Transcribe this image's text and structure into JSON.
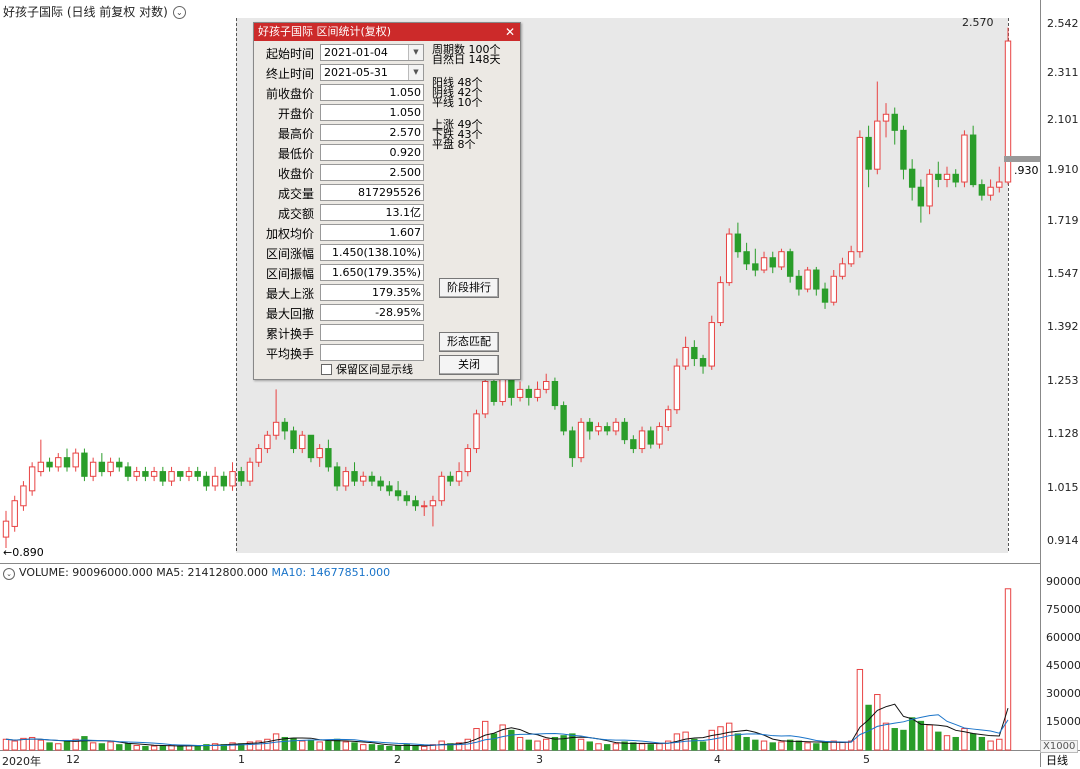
{
  "window": {
    "title": "好孩子国际 (日线 前复权 对数)",
    "period_tab": "日线",
    "colors": {
      "up": "#e84343",
      "down": "#2a9d2a",
      "ma5": "#111111",
      "ma10": "#1a74c9",
      "selection": "#e8e8e8",
      "dialog_title": "#cc2a2a"
    }
  },
  "price_axis": {
    "labels": [
      "2.542",
      "2.311",
      "2.101",
      "1.910",
      "1.719",
      "1.547",
      "1.392",
      "1.253",
      "1.128",
      "1.015",
      "0.914"
    ]
  },
  "price_annotations": {
    "high_label": "2.570",
    "low_label": "0.890",
    "current_label": ".930"
  },
  "volume_legend": {
    "name": "VOLUME: 90096000.000",
    "ma5": "MA5: 21412800.000",
    "ma10": "MA10: 14677851.000"
  },
  "volume_axis": {
    "labels": [
      "90000",
      "75000",
      "60000",
      "45000",
      "30000",
      "15000"
    ],
    "unit": "X1000"
  },
  "date_axis": {
    "labels": [
      "2020年",
      "12",
      "1",
      "2",
      "3",
      "4",
      "5"
    ]
  },
  "dialog": {
    "title": "好孩子国际 区间统计(复权)",
    "fields": [
      {
        "label": "起始时间",
        "value": "2021-01-04",
        "type": "date"
      },
      {
        "label": "终止时间",
        "value": "2021-05-31",
        "type": "date"
      },
      {
        "label": "前收盘价",
        "value": "1.050"
      },
      {
        "label": "开盘价",
        "value": "1.050"
      },
      {
        "label": "最高价",
        "value": "2.570"
      },
      {
        "label": "最低价",
        "value": "0.920"
      },
      {
        "label": "收盘价",
        "value": "2.500"
      },
      {
        "label": "成交量",
        "value": "817295526"
      },
      {
        "label": "成交额",
        "value": "13.1亿"
      },
      {
        "label": "加权均价",
        "value": "1.607"
      },
      {
        "label": "区间涨幅",
        "value": "1.450(138.10%)"
      },
      {
        "label": "区间振幅",
        "value": "1.650(179.35%)"
      },
      {
        "label": "最大上涨",
        "value": "179.35%"
      },
      {
        "label": "最大回撤",
        "value": "-28.95%"
      },
      {
        "label": "累计换手",
        "value": ""
      },
      {
        "label": "平均换手",
        "value": ""
      }
    ],
    "stats": [
      "周期数 100个",
      "自然日 148天",
      "阳线 48个",
      "阴线 42个",
      "平线 10个",
      "上涨 49个",
      "下跌 43个",
      "平盘 8个"
    ],
    "buttons": {
      "rank": "阶段排行",
      "pattern": "形态匹配",
      "close": "关闭"
    },
    "keep_checkbox_label": "保留区间显示线"
  },
  "chart_data": {
    "type": "candlestick",
    "title": "好孩子国际 (日线 前复权 对数)",
    "y_scale": "log",
    "y_range": [
      0.88,
      2.6
    ],
    "volume_range": [
      0,
      95000
    ],
    "volume_unit": "X1000",
    "selected_range": [
      "2021-01-04",
      "2021-05-31"
    ],
    "candles": [
      [
        0.9,
        0.93,
        0.88,
        0.95,
        6000
      ],
      [
        0.92,
        0.97,
        0.91,
        0.98,
        5000
      ],
      [
        0.96,
        1.0,
        0.95,
        1.01,
        6500
      ],
      [
        0.99,
        1.04,
        0.98,
        1.05,
        7000
      ],
      [
        1.03,
        1.05,
        1.02,
        1.1,
        5500
      ],
      [
        1.05,
        1.04,
        1.03,
        1.06,
        4000
      ],
      [
        1.04,
        1.06,
        1.03,
        1.07,
        3500
      ],
      [
        1.06,
        1.04,
        1.03,
        1.08,
        5000
      ],
      [
        1.04,
        1.07,
        1.03,
        1.08,
        6000
      ],
      [
        1.07,
        1.02,
        1.01,
        1.08,
        7500
      ],
      [
        1.02,
        1.05,
        1.01,
        1.06,
        4000
      ],
      [
        1.05,
        1.03,
        1.02,
        1.07,
        3500
      ],
      [
        1.03,
        1.05,
        1.02,
        1.06,
        4500
      ],
      [
        1.05,
        1.04,
        1.03,
        1.06,
        3000
      ],
      [
        1.04,
        1.02,
        1.01,
        1.05,
        3500
      ],
      [
        1.02,
        1.03,
        1.01,
        1.04,
        2500
      ],
      [
        1.03,
        1.02,
        1.01,
        1.04,
        2000
      ],
      [
        1.02,
        1.03,
        1.01,
        1.04,
        2200
      ],
      [
        1.03,
        1.01,
        1.0,
        1.04,
        2400
      ],
      [
        1.01,
        1.03,
        1.0,
        1.04,
        2600
      ],
      [
        1.03,
        1.02,
        1.01,
        1.03,
        2000
      ],
      [
        1.02,
        1.03,
        1.01,
        1.04,
        2300
      ],
      [
        1.03,
        1.02,
        1.01,
        1.04,
        2500
      ],
      [
        1.02,
        1.0,
        0.99,
        1.03,
        3000
      ],
      [
        1.0,
        1.02,
        0.99,
        1.04,
        3500
      ],
      [
        1.02,
        1.0,
        0.99,
        1.03,
        3000
      ],
      [
        1.0,
        1.03,
        0.99,
        1.05,
        4000
      ],
      [
        1.03,
        1.01,
        1.0,
        1.04,
        3500
      ],
      [
        1.01,
        1.05,
        1.0,
        1.06,
        4500
      ],
      [
        1.05,
        1.08,
        1.04,
        1.09,
        5000
      ],
      [
        1.08,
        1.11,
        1.07,
        1.12,
        6000
      ],
      [
        1.11,
        1.14,
        1.1,
        1.22,
        9000
      ],
      [
        1.14,
        1.12,
        1.1,
        1.15,
        7000
      ],
      [
        1.12,
        1.08,
        1.07,
        1.13,
        6500
      ],
      [
        1.08,
        1.11,
        1.07,
        1.12,
        5000
      ],
      [
        1.11,
        1.06,
        1.05,
        1.11,
        5500
      ],
      [
        1.06,
        1.08,
        1.04,
        1.09,
        4500
      ],
      [
        1.08,
        1.04,
        1.03,
        1.1,
        5000
      ],
      [
        1.04,
        1.0,
        0.99,
        1.05,
        6000
      ],
      [
        1.0,
        1.03,
        0.99,
        1.04,
        4500
      ],
      [
        1.03,
        1.01,
        1.0,
        1.05,
        4000
      ],
      [
        1.01,
        1.02,
        1.0,
        1.03,
        3000
      ],
      [
        1.02,
        1.01,
        1.0,
        1.03,
        3000
      ],
      [
        1.01,
        1.0,
        0.99,
        1.02,
        2500
      ],
      [
        1.0,
        0.99,
        0.98,
        1.01,
        2000
      ],
      [
        0.99,
        0.98,
        0.97,
        1.01,
        2500
      ],
      [
        0.98,
        0.97,
        0.96,
        0.99,
        3000
      ],
      [
        0.97,
        0.96,
        0.95,
        0.98,
        2500
      ],
      [
        0.96,
        0.96,
        0.94,
        0.97,
        2000
      ],
      [
        0.96,
        0.97,
        0.92,
        0.98,
        3000
      ],
      [
        0.97,
        1.02,
        0.96,
        1.03,
        5000
      ],
      [
        1.02,
        1.01,
        1.0,
        1.03,
        3500
      ],
      [
        1.01,
        1.03,
        1.0,
        1.05,
        4000
      ],
      [
        1.03,
        1.08,
        1.02,
        1.09,
        6000
      ],
      [
        1.08,
        1.16,
        1.07,
        1.17,
        12000
      ],
      [
        1.16,
        1.24,
        1.15,
        1.26,
        16000
      ],
      [
        1.24,
        1.19,
        1.18,
        1.25,
        9000
      ],
      [
        1.19,
        1.27,
        1.18,
        1.28,
        14000
      ],
      [
        1.27,
        1.2,
        1.18,
        1.28,
        11000
      ],
      [
        1.2,
        1.22,
        1.19,
        1.24,
        7000
      ],
      [
        1.22,
        1.2,
        1.18,
        1.23,
        5500
      ],
      [
        1.2,
        1.22,
        1.19,
        1.24,
        5000
      ],
      [
        1.22,
        1.24,
        1.21,
        1.26,
        6000
      ],
      [
        1.24,
        1.18,
        1.17,
        1.25,
        7000
      ],
      [
        1.18,
        1.12,
        1.11,
        1.19,
        8000
      ],
      [
        1.12,
        1.06,
        1.04,
        1.13,
        9000
      ],
      [
        1.06,
        1.14,
        1.05,
        1.15,
        6000
      ],
      [
        1.14,
        1.12,
        1.1,
        1.15,
        4500
      ],
      [
        1.12,
        1.13,
        1.11,
        1.14,
        3500
      ],
      [
        1.13,
        1.12,
        1.11,
        1.14,
        3000
      ],
      [
        1.12,
        1.14,
        1.11,
        1.15,
        3500
      ],
      [
        1.14,
        1.1,
        1.09,
        1.15,
        4500
      ],
      [
        1.1,
        1.08,
        1.07,
        1.11,
        4000
      ],
      [
        1.08,
        1.12,
        1.07,
        1.13,
        3500
      ],
      [
        1.12,
        1.09,
        1.08,
        1.13,
        3000
      ],
      [
        1.09,
        1.13,
        1.08,
        1.14,
        3500
      ],
      [
        1.13,
        1.17,
        1.12,
        1.18,
        5000
      ],
      [
        1.17,
        1.28,
        1.16,
        1.3,
        9000
      ],
      [
        1.28,
        1.33,
        1.27,
        1.36,
        10000
      ],
      [
        1.33,
        1.3,
        1.28,
        1.35,
        6000
      ],
      [
        1.3,
        1.28,
        1.26,
        1.31,
        4500
      ],
      [
        1.28,
        1.4,
        1.27,
        1.42,
        11000
      ],
      [
        1.4,
        1.52,
        1.39,
        1.54,
        13000
      ],
      [
        1.52,
        1.68,
        1.51,
        1.7,
        15000
      ],
      [
        1.68,
        1.62,
        1.6,
        1.72,
        9000
      ],
      [
        1.62,
        1.58,
        1.56,
        1.65,
        7000
      ],
      [
        1.58,
        1.56,
        1.54,
        1.63,
        5500
      ],
      [
        1.56,
        1.6,
        1.55,
        1.62,
        5000
      ],
      [
        1.6,
        1.57,
        1.55,
        1.62,
        4000
      ],
      [
        1.57,
        1.62,
        1.56,
        1.63,
        4500
      ],
      [
        1.62,
        1.54,
        1.52,
        1.63,
        5500
      ],
      [
        1.54,
        1.5,
        1.48,
        1.56,
        5000
      ],
      [
        1.5,
        1.56,
        1.49,
        1.57,
        4000
      ],
      [
        1.56,
        1.5,
        1.48,
        1.57,
        3500
      ],
      [
        1.5,
        1.46,
        1.44,
        1.52,
        4000
      ],
      [
        1.46,
        1.54,
        1.45,
        1.56,
        5000
      ],
      [
        1.54,
        1.58,
        1.53,
        1.6,
        4500
      ],
      [
        1.58,
        1.62,
        1.57,
        1.64,
        5000
      ],
      [
        1.62,
        2.05,
        1.6,
        2.08,
        45000
      ],
      [
        2.05,
        1.92,
        1.85,
        2.1,
        25000
      ],
      [
        1.92,
        2.12,
        1.9,
        2.3,
        31000
      ],
      [
        2.12,
        2.15,
        2.05,
        2.2,
        15000
      ],
      [
        2.15,
        2.08,
        2.02,
        2.18,
        12000
      ],
      [
        2.08,
        1.92,
        1.88,
        2.1,
        11000
      ],
      [
        1.92,
        1.85,
        1.8,
        1.96,
        18000
      ],
      [
        1.85,
        1.78,
        1.72,
        1.88,
        16000
      ],
      [
        1.78,
        1.9,
        1.75,
        1.92,
        14000
      ],
      [
        1.9,
        1.88,
        1.85,
        1.95,
        10000
      ],
      [
        1.88,
        1.9,
        1.85,
        1.93,
        8000
      ],
      [
        1.9,
        1.87,
        1.85,
        1.92,
        7000
      ],
      [
        1.87,
        2.06,
        1.85,
        2.08,
        12000
      ],
      [
        2.06,
        1.86,
        1.85,
        2.1,
        9000
      ],
      [
        1.86,
        1.82,
        1.8,
        1.88,
        7000
      ],
      [
        1.82,
        1.85,
        1.8,
        1.88,
        5000
      ],
      [
        1.85,
        1.87,
        1.83,
        1.93,
        6000
      ],
      [
        1.87,
        2.5,
        1.86,
        2.57,
        90096
      ]
    ]
  }
}
